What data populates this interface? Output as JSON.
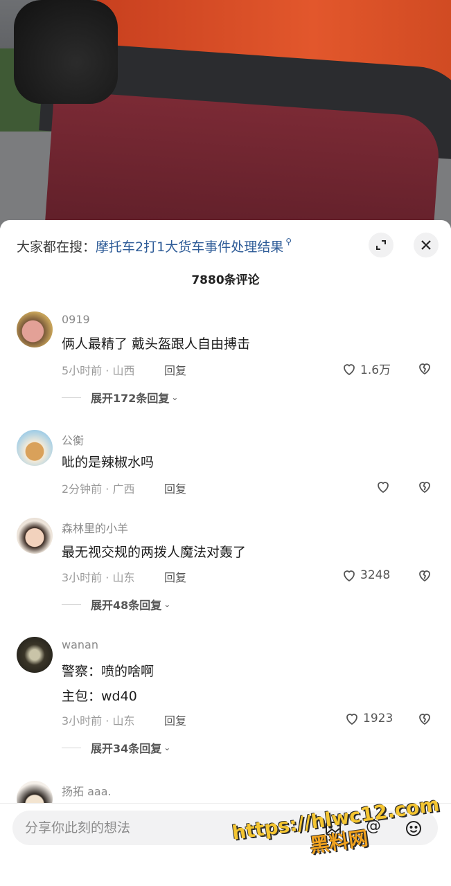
{
  "search_hint": {
    "prefix": "大家都在搜：",
    "query": "摩托车2打1大货车事件处理结果"
  },
  "comment_count_title": "7880条评论",
  "comments": [
    {
      "username": "0919",
      "lines": [
        "俩人最精了 戴头盔跟人自由搏击"
      ],
      "meta": "5小时前 · 山西",
      "reply": "回复",
      "likes": "1.6万",
      "expand": "展开172条回复"
    },
    {
      "username": "公衡",
      "lines": [
        "呲的是辣椒水吗"
      ],
      "meta": "2分钟前 · 广西",
      "reply": "回复",
      "likes": "",
      "expand": ""
    },
    {
      "username": "森林里的小羊",
      "lines": [
        "最无视交规的两拨人魔法对轰了"
      ],
      "meta": "3小时前 · 山东",
      "reply": "回复",
      "likes": "3248",
      "expand": "展开48条回复"
    },
    {
      "username": "wanan",
      "lines": [
        "警察：喷的啥啊",
        "主包：wd40"
      ],
      "meta": "3小时前 · 山东",
      "reply": "回复",
      "likes": "1923",
      "expand": "展开34条回复"
    },
    {
      "username": "扬拓 aaa."
    }
  ],
  "input": {
    "placeholder": "分享你此刻的想法"
  },
  "watermark": {
    "url": "https://hlwc12.com",
    "name": "黑料网"
  },
  "icons": {
    "expand": "expand-icon",
    "close": "close-icon",
    "like": "heart-icon",
    "dislike": "broken-heart-icon",
    "image": "image-icon",
    "mention": "at-icon",
    "emoji": "emoji-icon"
  }
}
